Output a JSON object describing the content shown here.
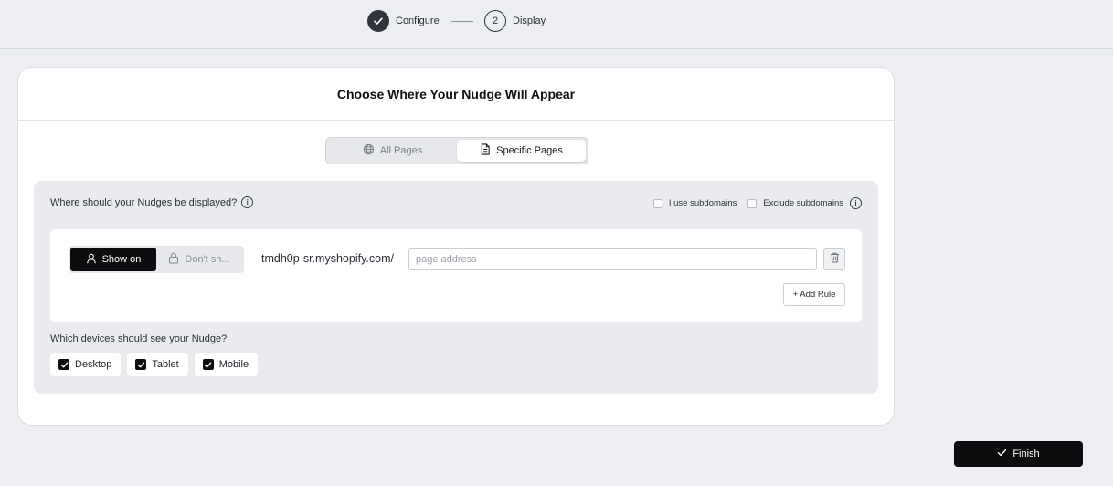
{
  "stepper": {
    "steps": [
      {
        "label": "Configure",
        "status": "done"
      },
      {
        "number": "2",
        "label": "Display",
        "status": "current"
      }
    ]
  },
  "card": {
    "title": "Choose Where Your Nudge Will Appear"
  },
  "page_scope": {
    "options": [
      {
        "label": "All Pages",
        "icon": "globe-icon",
        "active": false
      },
      {
        "label": "Specific Pages",
        "icon": "document-icon",
        "active": true
      }
    ]
  },
  "display": {
    "question": "Where should your Nudges be displayed?",
    "subdomains": [
      {
        "label": "I use subdomains",
        "checked": false
      },
      {
        "label": "Exclude subdomains",
        "checked": false
      }
    ],
    "rule": {
      "show_label": "Show on",
      "hide_label": "Don't sh...",
      "domain": "tmdh0p-sr.myshopify.com/",
      "address_placeholder": "page address",
      "address_value": ""
    },
    "add_rule_label": "+ Add Rule"
  },
  "devices": {
    "question": "Which devices should see your Nudge?",
    "options": [
      {
        "label": "Desktop",
        "checked": true
      },
      {
        "label": "Tablet",
        "checked": true
      },
      {
        "label": "Mobile",
        "checked": true
      }
    ]
  },
  "finish_label": "Finish",
  "colors": {
    "primary": "#0d0d0f",
    "background": "#eceef1",
    "panel": "#e9ebee"
  }
}
